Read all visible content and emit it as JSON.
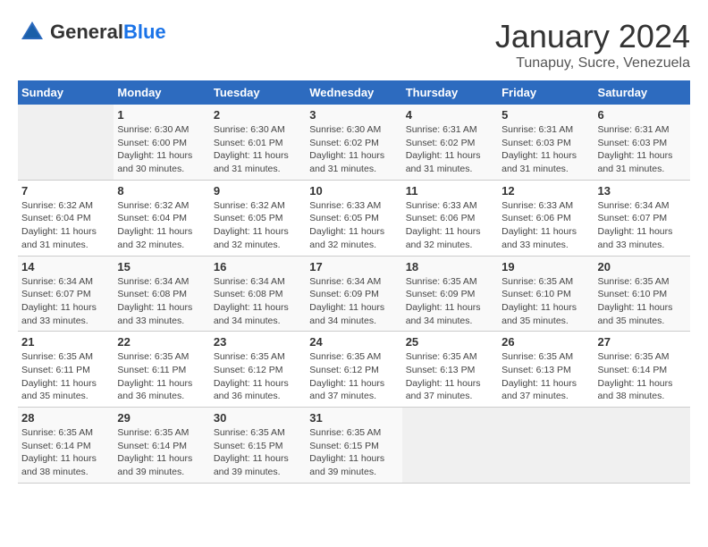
{
  "header": {
    "logo_general": "General",
    "logo_blue": "Blue",
    "title": "January 2024",
    "subtitle": "Tunapuy, Sucre, Venezuela"
  },
  "days_of_week": [
    "Sunday",
    "Monday",
    "Tuesday",
    "Wednesday",
    "Thursday",
    "Friday",
    "Saturday"
  ],
  "weeks": [
    [
      {
        "day": "",
        "info": ""
      },
      {
        "day": "1",
        "info": "Sunrise: 6:30 AM\nSunset: 6:00 PM\nDaylight: 11 hours\nand 30 minutes."
      },
      {
        "day": "2",
        "info": "Sunrise: 6:30 AM\nSunset: 6:01 PM\nDaylight: 11 hours\nand 31 minutes."
      },
      {
        "day": "3",
        "info": "Sunrise: 6:30 AM\nSunset: 6:02 PM\nDaylight: 11 hours\nand 31 minutes."
      },
      {
        "day": "4",
        "info": "Sunrise: 6:31 AM\nSunset: 6:02 PM\nDaylight: 11 hours\nand 31 minutes."
      },
      {
        "day": "5",
        "info": "Sunrise: 6:31 AM\nSunset: 6:03 PM\nDaylight: 11 hours\nand 31 minutes."
      },
      {
        "day": "6",
        "info": "Sunrise: 6:31 AM\nSunset: 6:03 PM\nDaylight: 11 hours\nand 31 minutes."
      }
    ],
    [
      {
        "day": "7",
        "info": "Sunrise: 6:32 AM\nSunset: 6:04 PM\nDaylight: 11 hours\nand 31 minutes."
      },
      {
        "day": "8",
        "info": "Sunrise: 6:32 AM\nSunset: 6:04 PM\nDaylight: 11 hours\nand 32 minutes."
      },
      {
        "day": "9",
        "info": "Sunrise: 6:32 AM\nSunset: 6:05 PM\nDaylight: 11 hours\nand 32 minutes."
      },
      {
        "day": "10",
        "info": "Sunrise: 6:33 AM\nSunset: 6:05 PM\nDaylight: 11 hours\nand 32 minutes."
      },
      {
        "day": "11",
        "info": "Sunrise: 6:33 AM\nSunset: 6:06 PM\nDaylight: 11 hours\nand 32 minutes."
      },
      {
        "day": "12",
        "info": "Sunrise: 6:33 AM\nSunset: 6:06 PM\nDaylight: 11 hours\nand 33 minutes."
      },
      {
        "day": "13",
        "info": "Sunrise: 6:34 AM\nSunset: 6:07 PM\nDaylight: 11 hours\nand 33 minutes."
      }
    ],
    [
      {
        "day": "14",
        "info": "Sunrise: 6:34 AM\nSunset: 6:07 PM\nDaylight: 11 hours\nand 33 minutes."
      },
      {
        "day": "15",
        "info": "Sunrise: 6:34 AM\nSunset: 6:08 PM\nDaylight: 11 hours\nand 33 minutes."
      },
      {
        "day": "16",
        "info": "Sunrise: 6:34 AM\nSunset: 6:08 PM\nDaylight: 11 hours\nand 34 minutes."
      },
      {
        "day": "17",
        "info": "Sunrise: 6:34 AM\nSunset: 6:09 PM\nDaylight: 11 hours\nand 34 minutes."
      },
      {
        "day": "18",
        "info": "Sunrise: 6:35 AM\nSunset: 6:09 PM\nDaylight: 11 hours\nand 34 minutes."
      },
      {
        "day": "19",
        "info": "Sunrise: 6:35 AM\nSunset: 6:10 PM\nDaylight: 11 hours\nand 35 minutes."
      },
      {
        "day": "20",
        "info": "Sunrise: 6:35 AM\nSunset: 6:10 PM\nDaylight: 11 hours\nand 35 minutes."
      }
    ],
    [
      {
        "day": "21",
        "info": "Sunrise: 6:35 AM\nSunset: 6:11 PM\nDaylight: 11 hours\nand 35 minutes."
      },
      {
        "day": "22",
        "info": "Sunrise: 6:35 AM\nSunset: 6:11 PM\nDaylight: 11 hours\nand 36 minutes."
      },
      {
        "day": "23",
        "info": "Sunrise: 6:35 AM\nSunset: 6:12 PM\nDaylight: 11 hours\nand 36 minutes."
      },
      {
        "day": "24",
        "info": "Sunrise: 6:35 AM\nSunset: 6:12 PM\nDaylight: 11 hours\nand 37 minutes."
      },
      {
        "day": "25",
        "info": "Sunrise: 6:35 AM\nSunset: 6:13 PM\nDaylight: 11 hours\nand 37 minutes."
      },
      {
        "day": "26",
        "info": "Sunrise: 6:35 AM\nSunset: 6:13 PM\nDaylight: 11 hours\nand 37 minutes."
      },
      {
        "day": "27",
        "info": "Sunrise: 6:35 AM\nSunset: 6:14 PM\nDaylight: 11 hours\nand 38 minutes."
      }
    ],
    [
      {
        "day": "28",
        "info": "Sunrise: 6:35 AM\nSunset: 6:14 PM\nDaylight: 11 hours\nand 38 minutes."
      },
      {
        "day": "29",
        "info": "Sunrise: 6:35 AM\nSunset: 6:14 PM\nDaylight: 11 hours\nand 39 minutes."
      },
      {
        "day": "30",
        "info": "Sunrise: 6:35 AM\nSunset: 6:15 PM\nDaylight: 11 hours\nand 39 minutes."
      },
      {
        "day": "31",
        "info": "Sunrise: 6:35 AM\nSunset: 6:15 PM\nDaylight: 11 hours\nand 39 minutes."
      },
      {
        "day": "",
        "info": ""
      },
      {
        "day": "",
        "info": ""
      },
      {
        "day": "",
        "info": ""
      }
    ]
  ]
}
